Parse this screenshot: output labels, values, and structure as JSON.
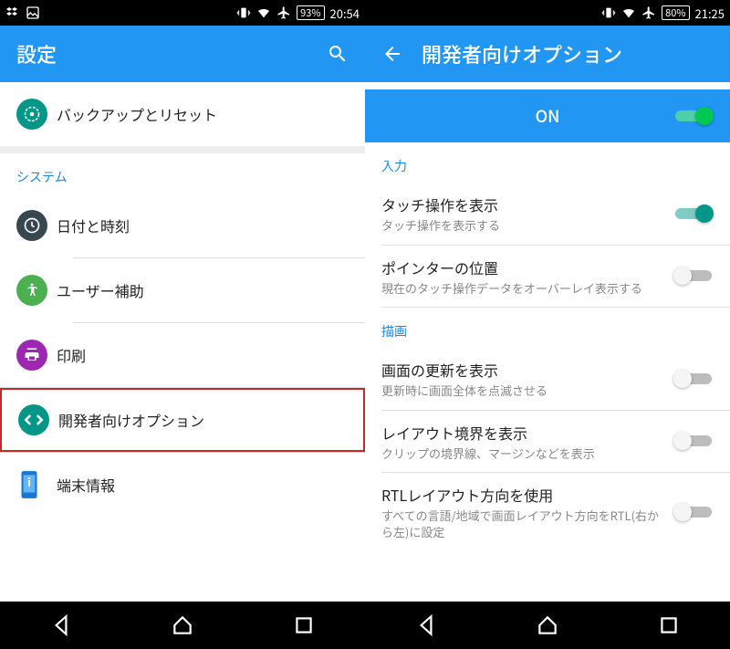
{
  "left": {
    "status": {
      "battery": "93%",
      "time": "20:54"
    },
    "title": "設定",
    "item_backup": "バックアップとリセット",
    "section_system": "システム",
    "item_datetime": "日付と時刻",
    "item_accessibility": "ユーザー補助",
    "item_print": "印刷",
    "item_devopts": "開発者向けオプション",
    "item_about": "端末情報"
  },
  "right": {
    "status": {
      "battery": "80%",
      "time": "21:25"
    },
    "title": "開発者向けオプション",
    "master_label": "ON",
    "section_input": "入力",
    "touch": {
      "label": "タッチ操作を表示",
      "sub": "タッチ操作を表示する"
    },
    "pointer": {
      "label": "ポインターの位置",
      "sub": "現在のタッチ操作データをオーバーレイ表示する"
    },
    "section_draw": "描画",
    "screenupd": {
      "label": "画面の更新を表示",
      "sub": "更新時に画面全体を点滅させる"
    },
    "layout": {
      "label": "レイアウト境界を表示",
      "sub": "クリップの境界線、マージンなどを表示"
    },
    "rtl": {
      "label": "RTLレイアウト方向を使用",
      "sub": "すべての言語/地域で画面レイアウト方向をRTL(右から左)に設定"
    }
  }
}
